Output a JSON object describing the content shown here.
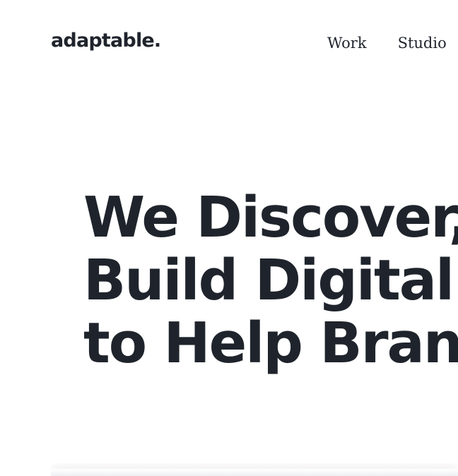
{
  "brand": {
    "logo_text": "adaptable."
  },
  "nav": {
    "items": [
      {
        "label": "Work"
      },
      {
        "label": "Studio"
      }
    ]
  },
  "hero": {
    "lines": [
      "We Discover, D",
      "Build Digital Ex",
      "to Help Brands"
    ]
  },
  "colors": {
    "text": "#1f242c",
    "background": "#ffffff"
  }
}
